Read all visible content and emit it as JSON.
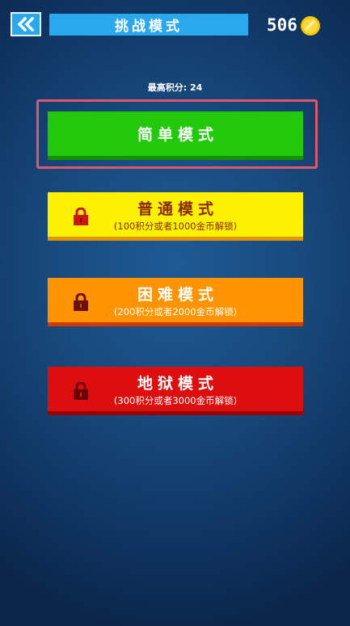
{
  "header": {
    "title": "挑战模式",
    "coins": "506"
  },
  "high_score": {
    "text": "最高积分: 24"
  },
  "modes": [
    {
      "title": "简单模式",
      "locked": false
    },
    {
      "title": "普通模式",
      "subtitle": "(100积分或者1000金币解锁)",
      "locked": true
    },
    {
      "title": "困难模式",
      "subtitle": "(200积分或者2000金币解锁)",
      "locked": true
    },
    {
      "title": "地狱模式",
      "subtitle": "(300积分或者3000金币解锁)",
      "locked": true
    }
  ],
  "icons": {
    "back": "double-chevron-left-icon",
    "coin": "coin-icon",
    "lock": "lock-icon"
  },
  "colors": {
    "header_blue": "#29a8ee",
    "easy": "#22c90a",
    "normal": "#fcf100",
    "hard": "#ff9300",
    "hell": "#dd0e0e",
    "selection": "#e0566a",
    "coin": "#f5c400"
  }
}
